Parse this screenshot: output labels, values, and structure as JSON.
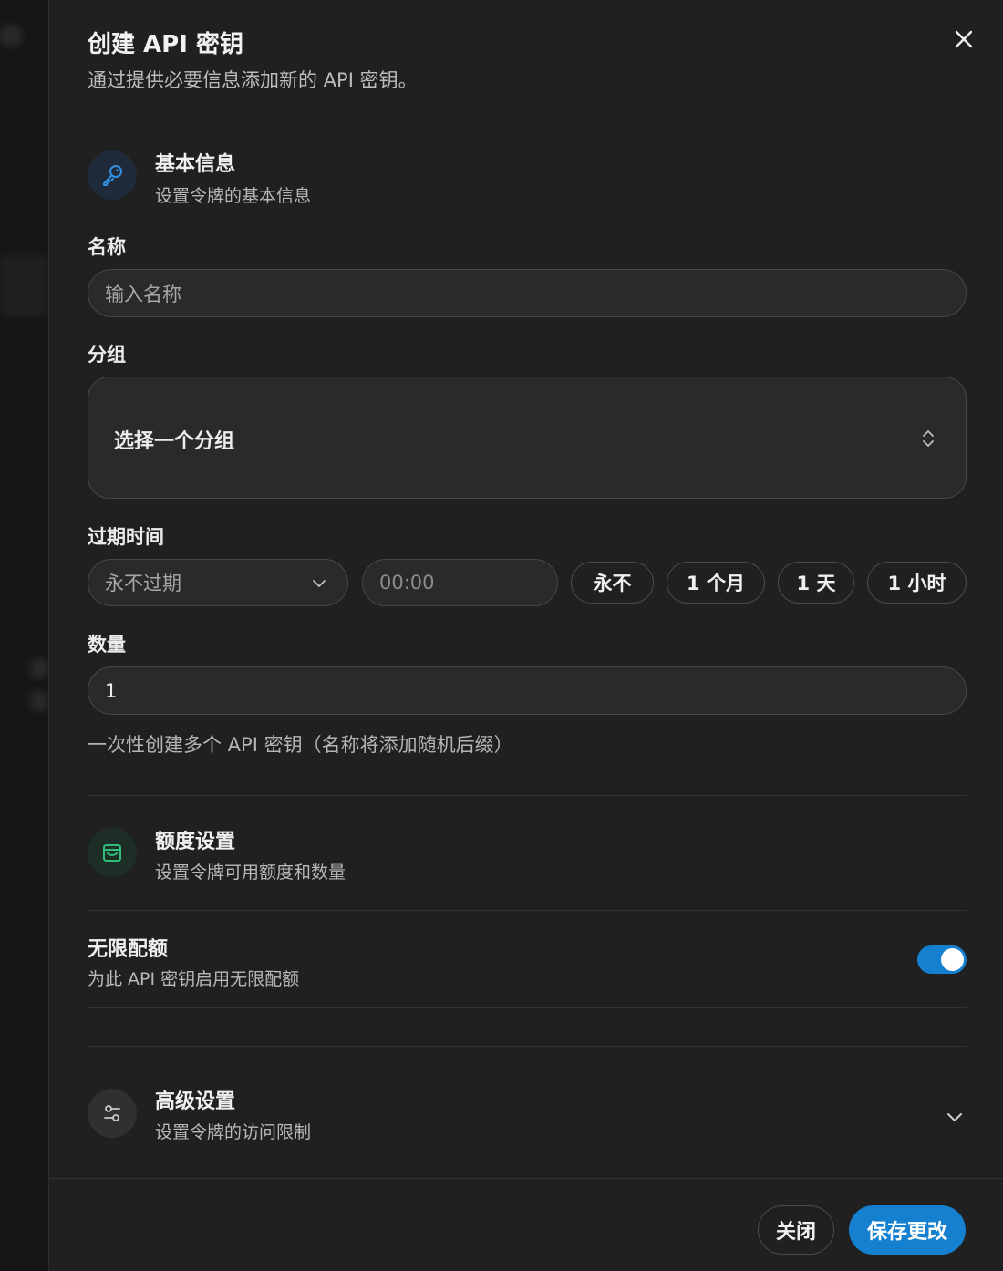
{
  "header": {
    "title": "创建 API 密钥",
    "subtitle": "通过提供必要信息添加新的 API 密钥。",
    "close_icon": "close-icon"
  },
  "basic": {
    "title": "基本信息",
    "desc": "设置令牌的基本信息",
    "icon": "key-icon",
    "icon_color": "#2f8fe0"
  },
  "form": {
    "name_label": "名称",
    "name_placeholder": "输入名称",
    "group_label": "分组",
    "group_placeholder": "选择一个分组",
    "expire_label": "过期时间",
    "expire_select_value": "永不过期",
    "time_placeholder": "00:00",
    "expire_chips": [
      "永不",
      "1 个月",
      "1 天",
      "1 小时"
    ],
    "quantity_label": "数量",
    "quantity_value": "1",
    "quantity_hint": "一次性创建多个 API 密钥（名称将添加随机后缀）"
  },
  "quota": {
    "title": "额度设置",
    "desc": "设置令牌可用额度和数量",
    "icon": "wallet-icon",
    "icon_color": "#2fbf7a",
    "unlimited_title": "无限配额",
    "unlimited_desc": "为此 API 密钥启用无限配额",
    "unlimited_enabled": true
  },
  "advanced": {
    "title": "高级设置",
    "desc": "设置令牌的访问限制",
    "icon": "sliders-icon"
  },
  "footer": {
    "close_label": "关闭",
    "save_label": "保存更改"
  },
  "colors": {
    "accent": "#1580cf",
    "panel_bg": "#202021"
  }
}
